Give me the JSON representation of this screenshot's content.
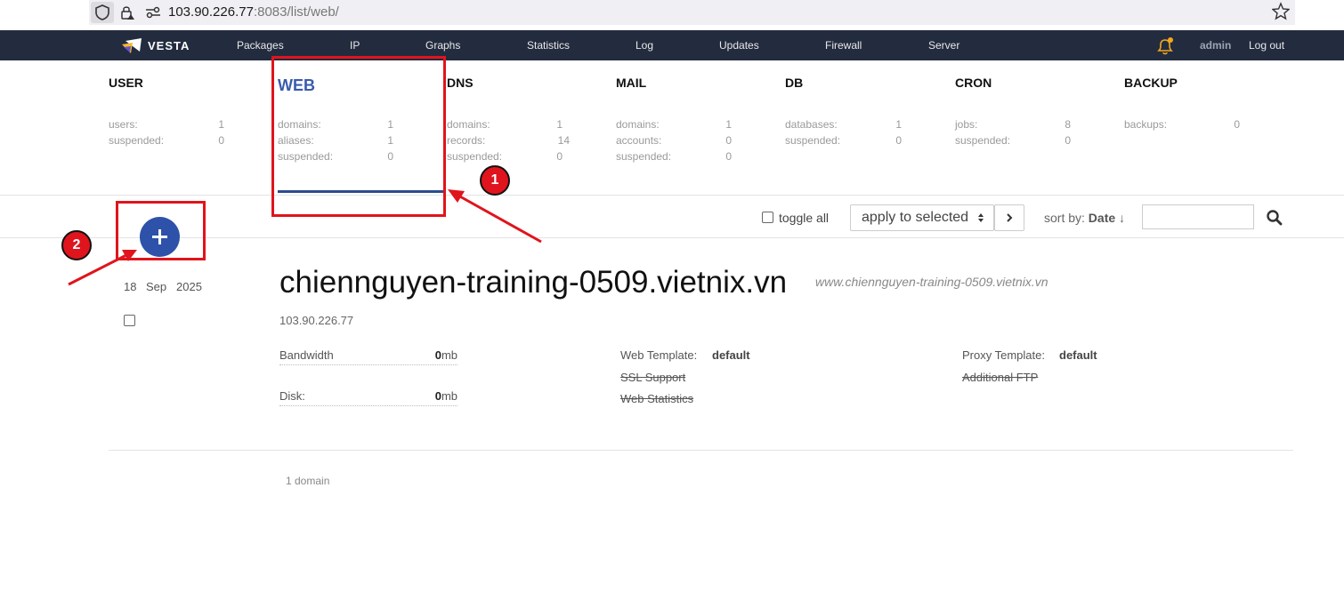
{
  "browser": {
    "url_host": "103.90.226.77",
    "url_rest": ":8083/list/web/"
  },
  "nav": {
    "brand": "VESTA",
    "items": [
      "Packages",
      "IP",
      "Graphs",
      "Statistics",
      "Log",
      "Updates",
      "Firewall",
      "Server"
    ],
    "user": "admin",
    "logout": "Log out"
  },
  "panels": [
    {
      "title": "USER",
      "stats": [
        {
          "label": "users:",
          "value": "1"
        },
        {
          "label": "suspended:",
          "value": "0"
        }
      ]
    },
    {
      "title": "WEB",
      "active": true,
      "stats": [
        {
          "label": "domains:",
          "value": "1"
        },
        {
          "label": "aliases:",
          "value": "1"
        },
        {
          "label": "suspended:",
          "value": "0"
        }
      ]
    },
    {
      "title": "DNS",
      "stats": [
        {
          "label": "domains:",
          "value": "1"
        },
        {
          "label": "records:",
          "value": "14"
        },
        {
          "label": "suspended:",
          "value": "0"
        }
      ]
    },
    {
      "title": "MAIL",
      "stats": [
        {
          "label": "domains:",
          "value": "1"
        },
        {
          "label": "accounts:",
          "value": "0"
        },
        {
          "label": "suspended:",
          "value": "0"
        }
      ]
    },
    {
      "title": "DB",
      "stats": [
        {
          "label": "databases:",
          "value": "1"
        },
        {
          "label": "suspended:",
          "value": "0"
        }
      ]
    },
    {
      "title": "CRON",
      "stats": [
        {
          "label": "jobs:",
          "value": "8"
        },
        {
          "label": "suspended:",
          "value": "0"
        }
      ]
    },
    {
      "title": "BACKUP",
      "stats": [
        {
          "label": "backups:",
          "value": "0"
        }
      ]
    }
  ],
  "toolbar": {
    "toggle_all": "toggle all",
    "apply_selected": "apply to selected",
    "sort_label": "sort by:",
    "sort_value": "Date",
    "sort_arrow": "↓"
  },
  "record": {
    "date": {
      "day": "18",
      "month": "Sep",
      "year": "2025"
    },
    "domain": "chiennguyen-training-0509.vietnix.vn",
    "alias": "www.chiennguyen-training-0509.vietnix.vn",
    "ip": "103.90.226.77",
    "bandwidth_label": "Bandwidth",
    "bandwidth_value": "0",
    "bandwidth_unit": "mb",
    "disk_label": "Disk:",
    "disk_value": "0",
    "disk_unit": "mb",
    "web_template_label": "Web Template:",
    "web_template_value": "default",
    "ssl_support": "SSL Support",
    "web_statistics": "Web Statistics",
    "proxy_template_label": "Proxy Template:",
    "proxy_template_value": "default",
    "additional_ftp": "Additional FTP"
  },
  "footer": {
    "count": "1 domain"
  },
  "annotations": {
    "badge1": "1",
    "badge2": "2"
  },
  "colors": {
    "nav_bg": "#232c3f",
    "accent": "#2e52a9",
    "annotation": "#e0141c"
  },
  "icons": [
    "shield-icon",
    "lock-icon",
    "site-settings-icon",
    "star-icon",
    "vesta-logo-icon",
    "bell-icon",
    "chevron-right-icon",
    "sort-arrows-icon",
    "search-icon",
    "plus-icon"
  ]
}
